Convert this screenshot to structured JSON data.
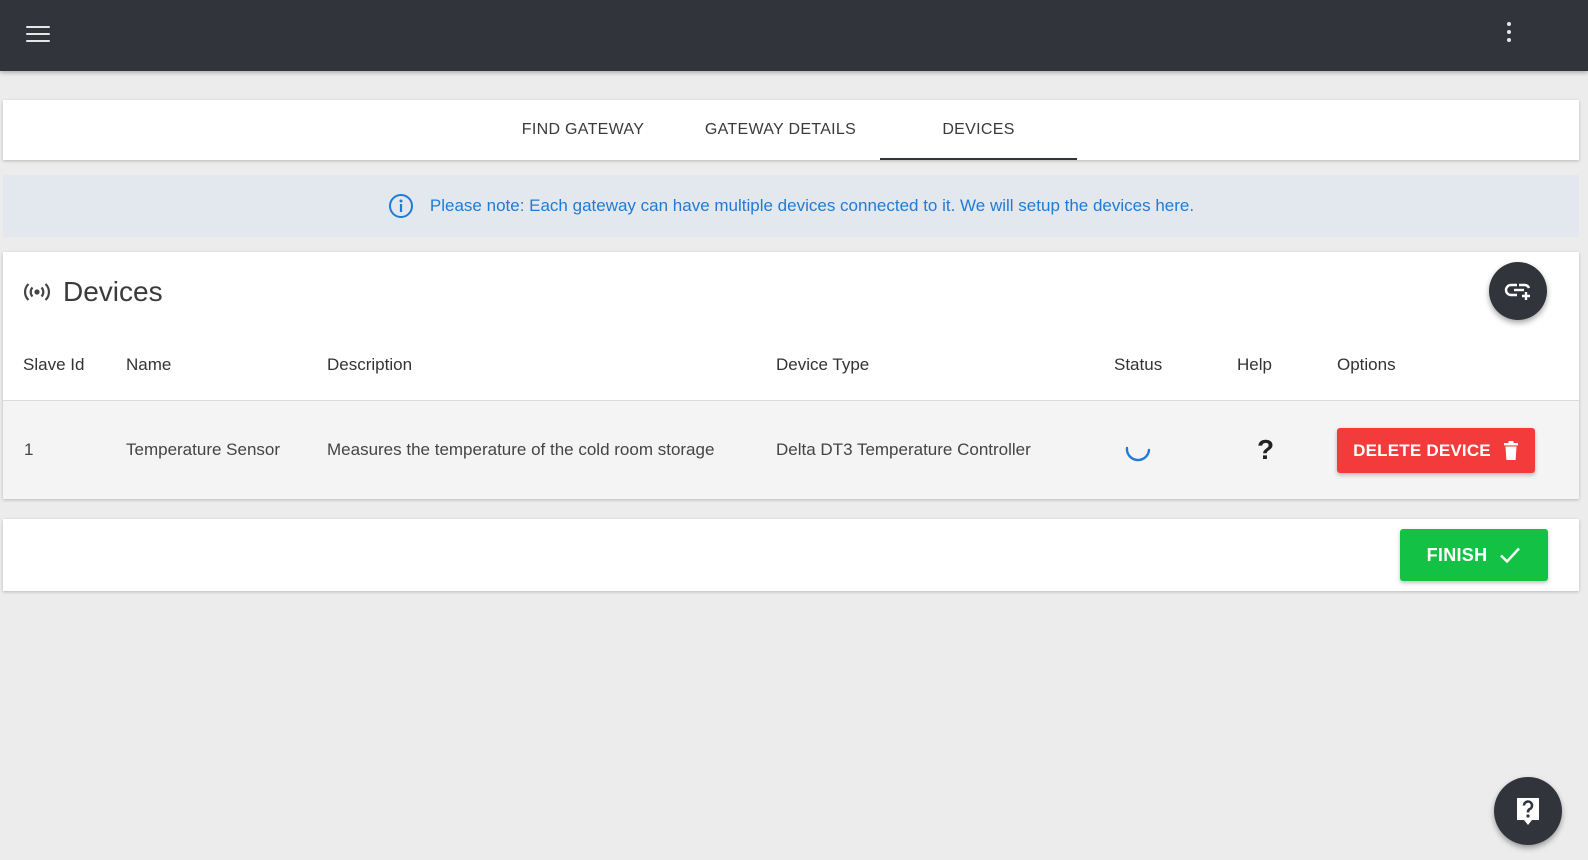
{
  "tabs": [
    {
      "label": "FIND GATEWAY",
      "active": false
    },
    {
      "label": "GATEWAY DETAILS",
      "active": false
    },
    {
      "label": "DEVICES",
      "active": true
    }
  ],
  "note": {
    "text": "Please note: Each gateway can have multiple devices connected to it. We will setup the devices here.",
    "icon": "info-icon",
    "color": "#1f7bd6"
  },
  "devices": {
    "title": "Devices",
    "icon": "wireless-signal-icon",
    "add_icon": "link-add-icon",
    "columns": [
      "Slave Id",
      "Name",
      "Description",
      "Device Type",
      "Status",
      "Help",
      "Options"
    ],
    "rows": [
      {
        "slave_id": "1",
        "name": "Temperature Sensor",
        "description": "Measures the temperature of the cold room storage",
        "device_type": "Delta DT3 Temperature Controller",
        "status": "loading",
        "help": "?",
        "option_label": "DELETE DEVICE"
      }
    ]
  },
  "finish": {
    "label": "FINISH"
  },
  "colors": {
    "topbar": "#32343c",
    "delete": "#f43b3b",
    "finish": "#13c244",
    "spinner": "#1f7bd6"
  }
}
